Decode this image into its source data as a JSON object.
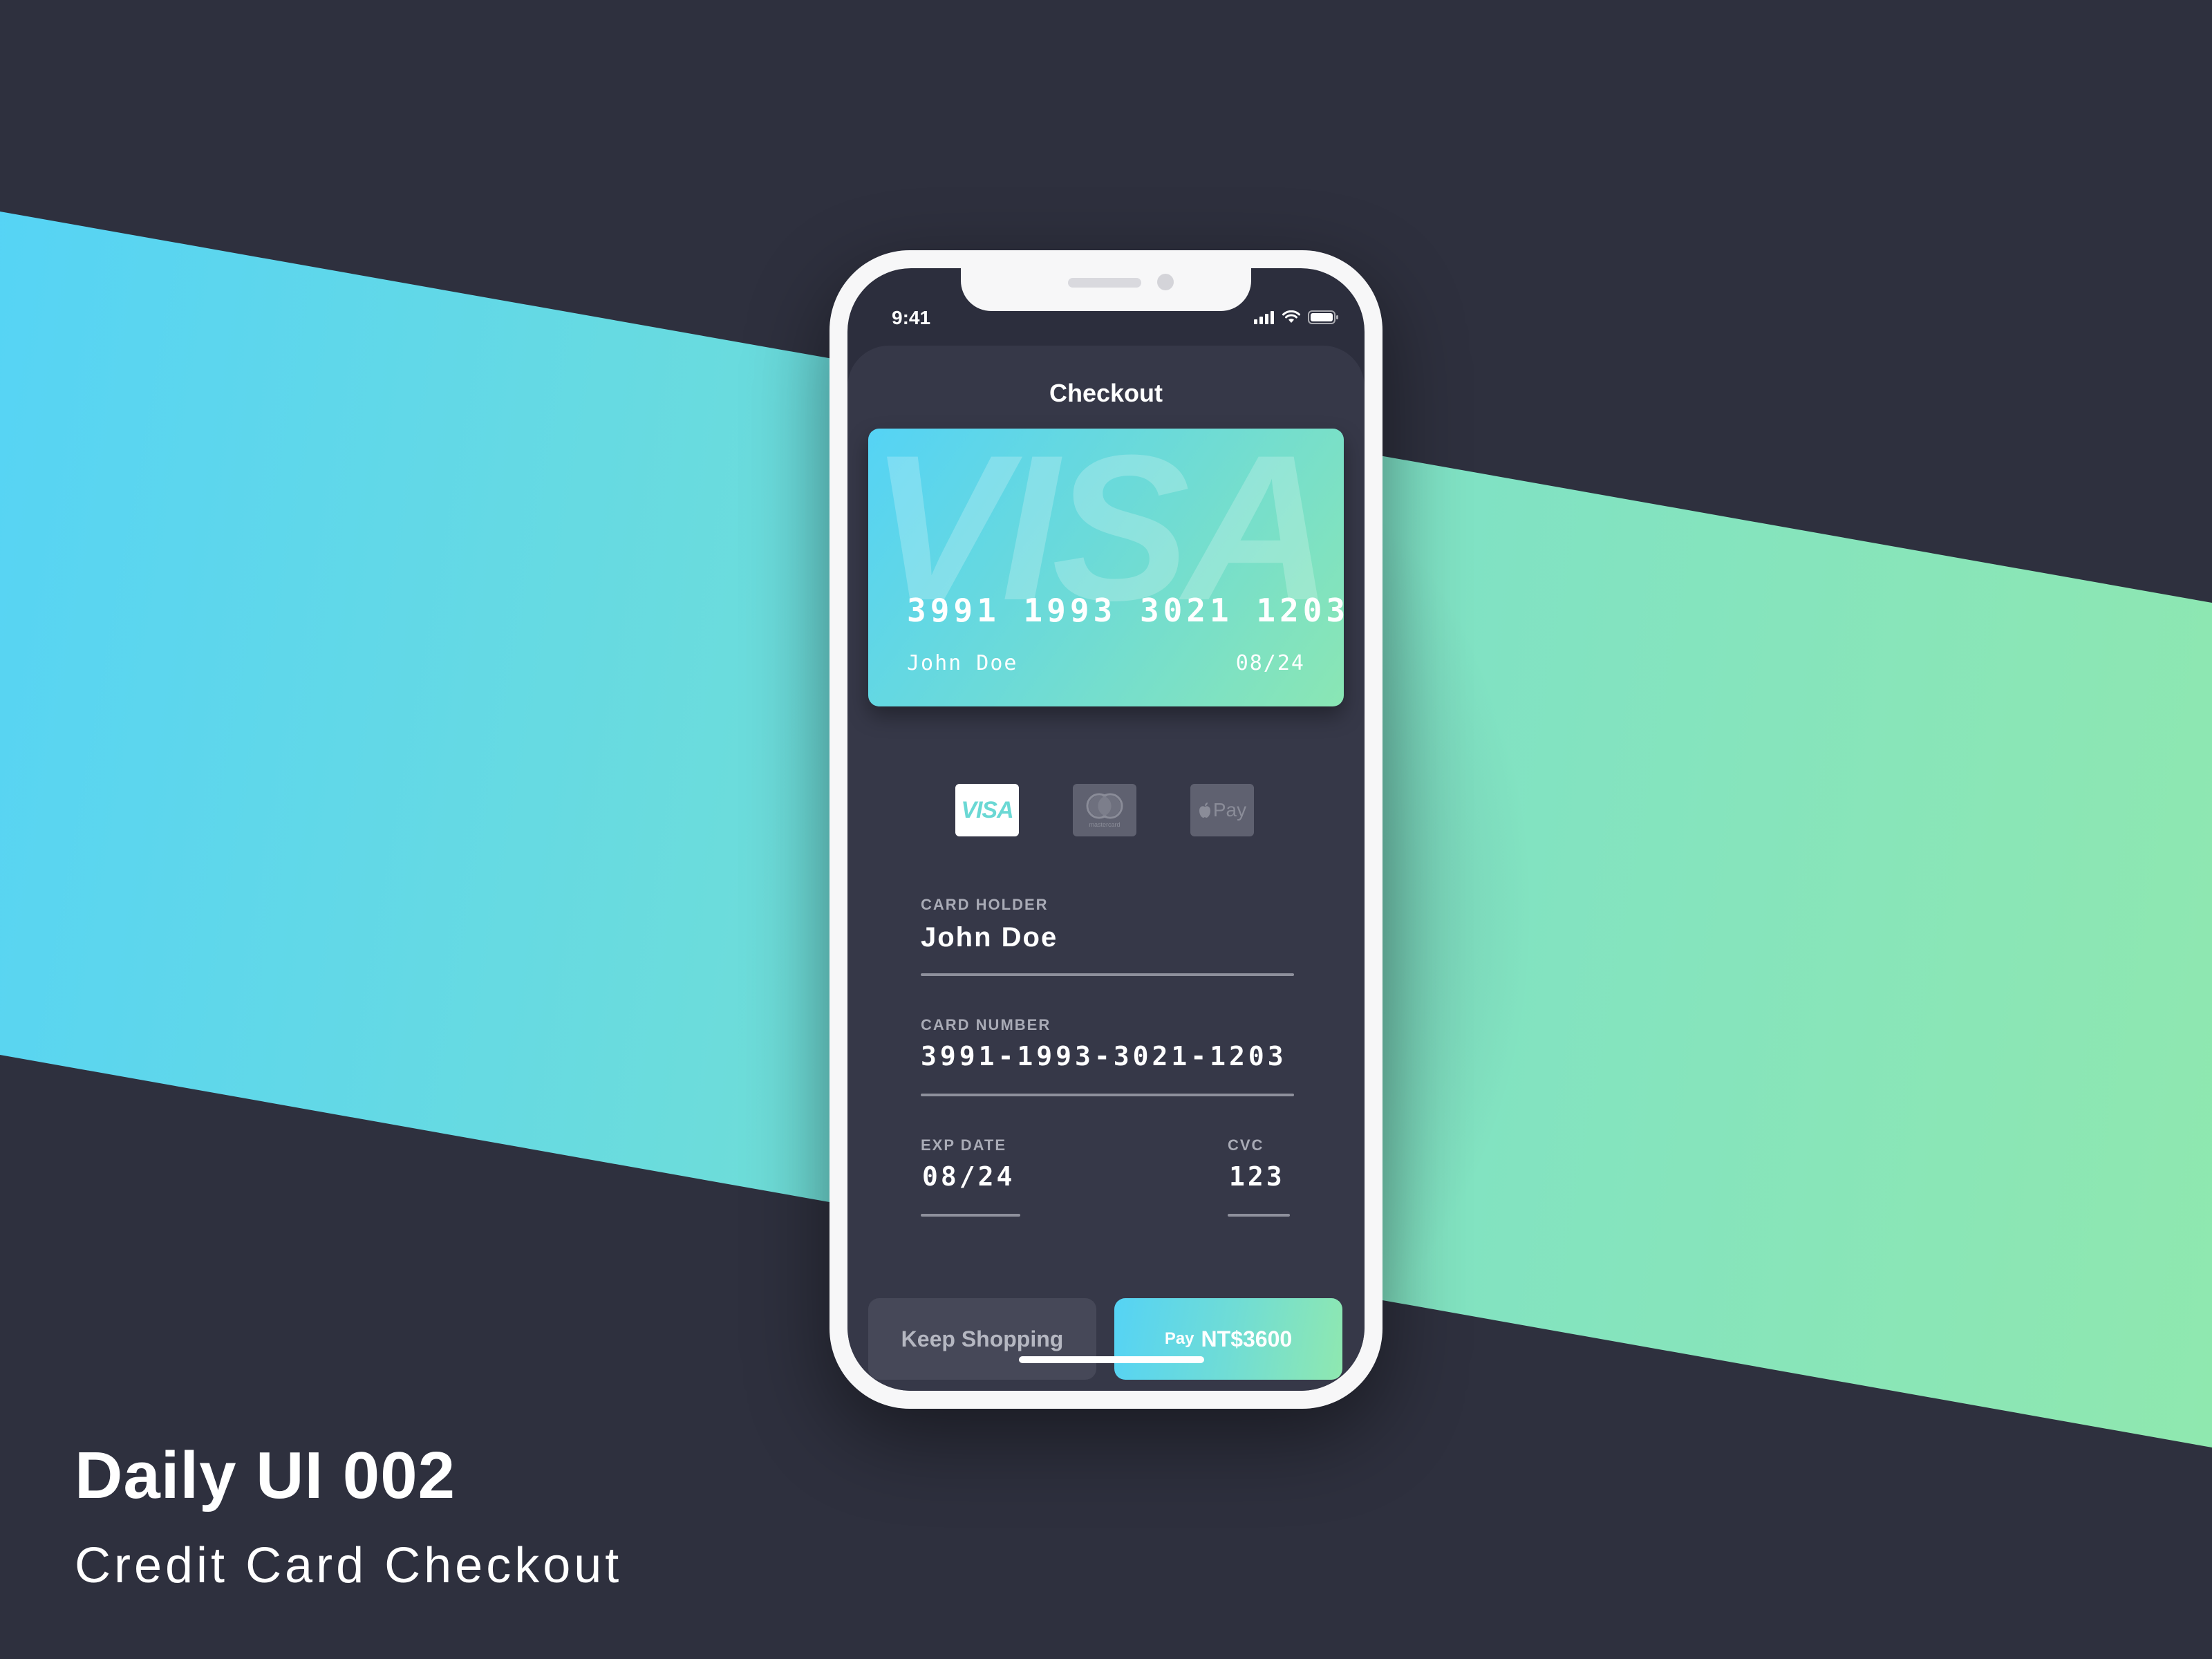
{
  "caption": {
    "title": "Daily UI 002",
    "subtitle": "Credit Card Checkout"
  },
  "status_bar": {
    "time": "9:41",
    "icons": [
      "signal-icon",
      "wifi-icon",
      "battery-icon"
    ]
  },
  "screen": {
    "title": "Checkout"
  },
  "card_preview": {
    "brand_watermark": "VISA",
    "number": "3991 1993 3021 1203",
    "holder": "John Doe",
    "expiry": "08/24"
  },
  "payment_methods": [
    {
      "name": "visa",
      "label": "VISA",
      "selected": true
    },
    {
      "name": "mastercard",
      "label": "mastercard",
      "selected": false
    },
    {
      "name": "apple-pay",
      "label": "Pay",
      "selected": false
    }
  ],
  "form": {
    "card_holder": {
      "label": "CARD HOLDER",
      "value": "John Doe"
    },
    "card_number": {
      "label": "CARD NUMBER",
      "value": "3991-1993-3021-1203"
    },
    "exp_date": {
      "label": "EXP DATE",
      "value": "08/24"
    },
    "cvc": {
      "label": "CVC",
      "value": "123"
    }
  },
  "buttons": {
    "keep_shopping": "Keep Shopping",
    "pay_prefix": "Pay",
    "pay_amount": "NT$3600"
  },
  "colors": {
    "background": "#2e303e",
    "accent_start": "#55d3f6",
    "accent_end": "#90e8ae",
    "screen_bg": "#363848"
  }
}
